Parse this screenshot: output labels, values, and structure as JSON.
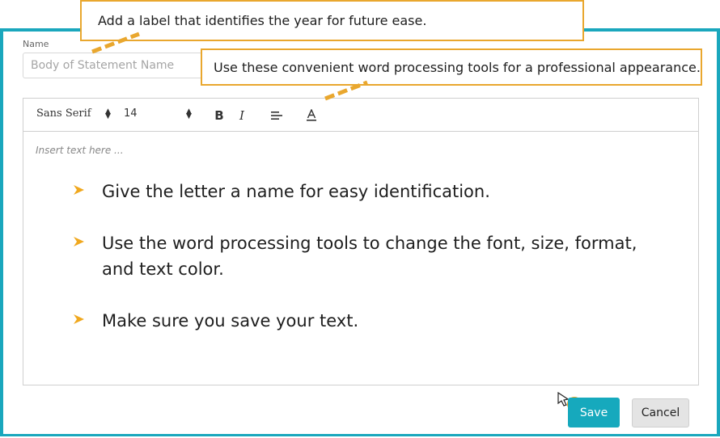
{
  "form": {
    "name_label": "Name",
    "name_placeholder": "Body of Statement Name"
  },
  "toolbar": {
    "font": "Sans Serif",
    "size": "14",
    "bold_icon": "bold-icon",
    "italic_icon": "italic-icon",
    "align_icon": "align-left-icon",
    "color_icon": "text-color-icon"
  },
  "editor": {
    "placeholder": "Insert text here ...",
    "bullets": [
      "Give the letter a name for easy identification.",
      "Use the word processing tools to change the font, size, format, and text color.",
      "Make sure you save your text."
    ]
  },
  "callouts": {
    "top": "Add a label that identifies the year for future ease.",
    "tools": "Use these convenient word processing tools for a professional appearance."
  },
  "actions": {
    "save": "Save",
    "cancel": "Cancel"
  },
  "colors": {
    "accent": "#1aa7bd",
    "callout_border": "#e9a72e",
    "bullet": "#f0a81e"
  }
}
